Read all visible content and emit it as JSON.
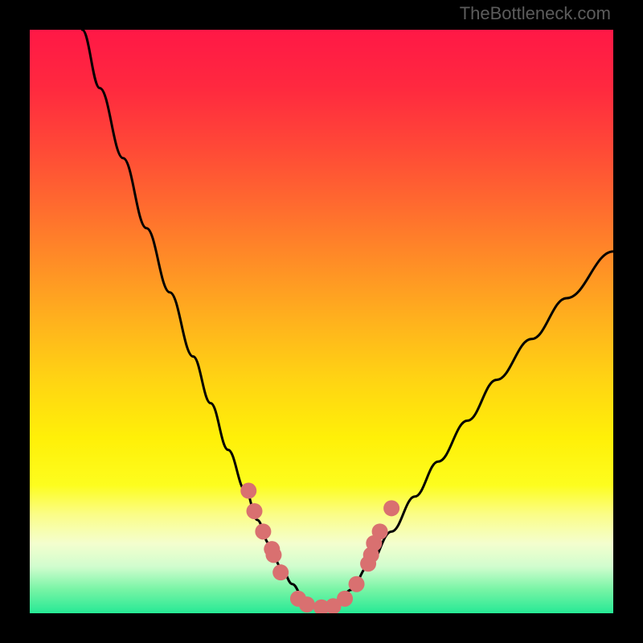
{
  "watermark": "TheBottleneck.com",
  "chart_data": {
    "type": "line",
    "title": "",
    "xlabel": "",
    "ylabel": "",
    "xlim": [
      0,
      100
    ],
    "ylim": [
      0,
      100
    ],
    "grid": false,
    "legend": false,
    "annotations": [],
    "series": [
      {
        "name": "bottleneck-curve",
        "color": "#000000",
        "x": [
          9,
          12,
          16,
          20,
          24,
          28,
          31,
          34,
          37,
          39,
          41,
          43,
          45,
          47,
          49,
          51,
          53,
          55,
          58,
          62,
          66,
          70,
          75,
          80,
          86,
          92,
          100
        ],
        "values": [
          100,
          90,
          78,
          66,
          55,
          44,
          36,
          28,
          21,
          16,
          12,
          8,
          5,
          2.5,
          1,
          1,
          2,
          4,
          8,
          14,
          20,
          26,
          33,
          40,
          47,
          54,
          62
        ]
      }
    ],
    "markers": {
      "name": "bottleneck-markers",
      "color": "#d97070",
      "radius_px": 10,
      "x": [
        37.5,
        38.5,
        40,
        41.5,
        41.8,
        43,
        46,
        47.5,
        50,
        52,
        54,
        56,
        58,
        58.5,
        59,
        60,
        62
      ],
      "values": [
        21,
        17.5,
        14,
        11,
        10,
        7,
        2.5,
        1.5,
        1,
        1.2,
        2.5,
        5,
        8.5,
        10,
        12,
        14,
        18
      ]
    },
    "background_gradient": {
      "direction": "vertical",
      "stops": [
        {
          "pos": 0.0,
          "color": "#ff1846"
        },
        {
          "pos": 0.5,
          "color": "#ffb21d"
        },
        {
          "pos": 0.78,
          "color": "#fdfd1e"
        },
        {
          "pos": 1.0,
          "color": "#26e995"
        }
      ]
    }
  }
}
